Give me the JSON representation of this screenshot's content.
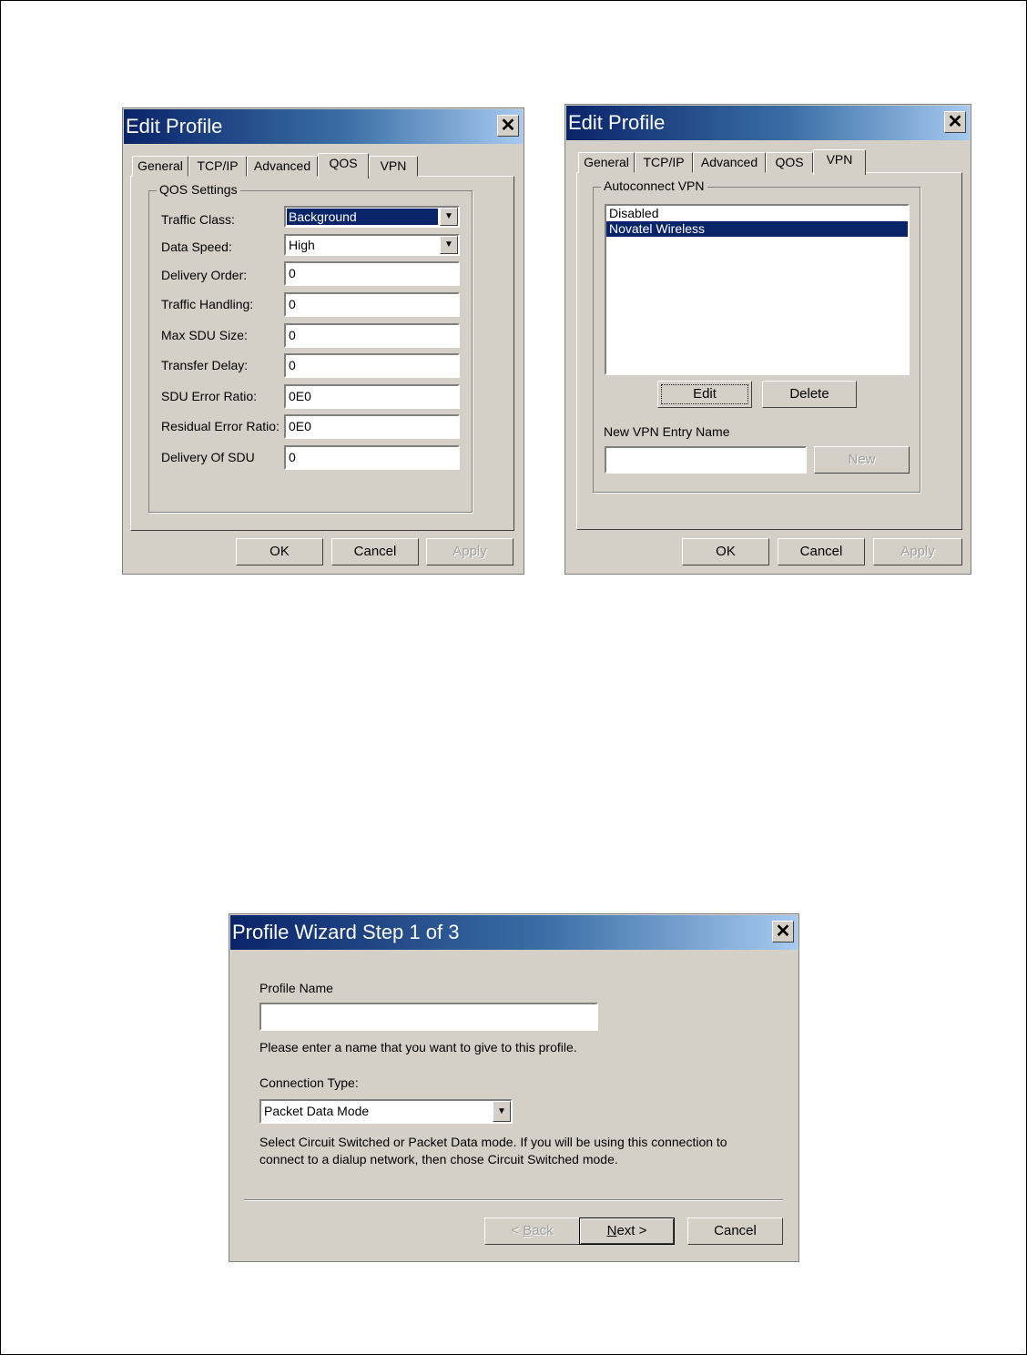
{
  "qos_dialog": {
    "title": "Edit Profile",
    "close": "✕",
    "tabs": [
      "General",
      "TCP/IP",
      "Advanced",
      "QOS",
      "VPN"
    ],
    "group_title": "QOS Settings",
    "fields": [
      {
        "label": "Traffic Class:",
        "value": "Background"
      },
      {
        "label": "Data Speed:",
        "value": "High"
      },
      {
        "label": "Delivery Order:",
        "value": "0"
      },
      {
        "label": "Traffic Handling:",
        "value": "0"
      },
      {
        "label": "Max SDU Size:",
        "value": "0"
      },
      {
        "label": "Transfer Delay:",
        "value": "0"
      },
      {
        "label": "SDU Error Ratio:",
        "value": "0E0"
      },
      {
        "label": "Residual Error Ratio:",
        "value": "0E0"
      },
      {
        "label": "Delivery Of SDU",
        "value": "0"
      }
    ],
    "buttons": {
      "ok": "OK",
      "cancel": "Cancel",
      "apply": "Apply"
    }
  },
  "vpn_dialog": {
    "title": "Edit Profile",
    "close": "✕",
    "tabs": [
      "General",
      "TCP/IP",
      "Advanced",
      "QOS",
      "VPN"
    ],
    "group_title": "Autoconnect VPN",
    "list_items": [
      "Disabled",
      "Novatel Wireless"
    ],
    "edit_label": "Edit",
    "delete_label": "Delete",
    "new_entry_label": "New VPN Entry Name",
    "new_entry_value": "",
    "new_label": "New",
    "buttons": {
      "ok": "OK",
      "cancel": "Cancel",
      "apply": "Apply"
    }
  },
  "wizard": {
    "title": "Profile Wizard Step 1 of 3",
    "close": "✕",
    "profile_name_label": "Profile Name",
    "profile_name_value": "",
    "profile_name_hint": "Please enter a name that you want to give to this profile.",
    "connection_type_label": "Connection Type:",
    "connection_type_value": "Packet Data Mode",
    "connection_hint_1": "Select Circuit Switched or Packet Data mode.  If you will be using this connection to",
    "connection_hint_2": "connect to a dialup network, then chose Circuit Switched mode.",
    "back": {
      "prefix": "< ",
      "key": "B",
      "rest": "ack"
    },
    "next": {
      "key": "N",
      "rest": "ext >"
    },
    "cancel": "Cancel"
  },
  "icons": {
    "dropdown": "▼"
  }
}
